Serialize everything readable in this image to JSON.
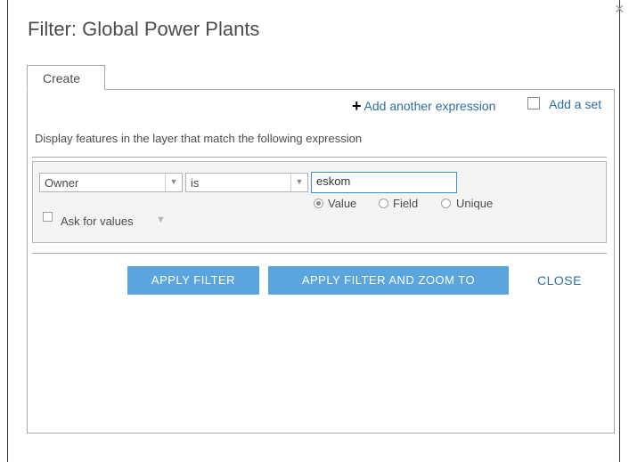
{
  "dialog": {
    "title": "Filter: Global Power Plants",
    "close_glyph": "×"
  },
  "tabs": [
    {
      "label": "Create"
    }
  ],
  "toolbar": {
    "add_expression": "Add another expression",
    "add_set": "Add a set"
  },
  "hint": "Display features in the layer that match the following expression",
  "expression": {
    "field": "Owner",
    "operator": "is",
    "value": "eskom",
    "value_types": [
      {
        "label": "Value",
        "selected": true
      },
      {
        "label": "Field",
        "selected": false
      },
      {
        "label": "Unique",
        "selected": false
      }
    ],
    "ask_for_values": {
      "label": "Ask for values",
      "checked": false
    }
  },
  "buttons": {
    "apply": "APPLY FILTER",
    "apply_zoom": "APPLY FILTER AND ZOOM TO",
    "close": "CLOSE"
  },
  "colors": {
    "accent": "#5aa5dd",
    "link": "#2e6da4",
    "input_focus_border": "#3d8fd1"
  },
  "icons": {
    "add": "plus-icon",
    "dropdown": "caret-down-icon",
    "close": "close-icon"
  }
}
